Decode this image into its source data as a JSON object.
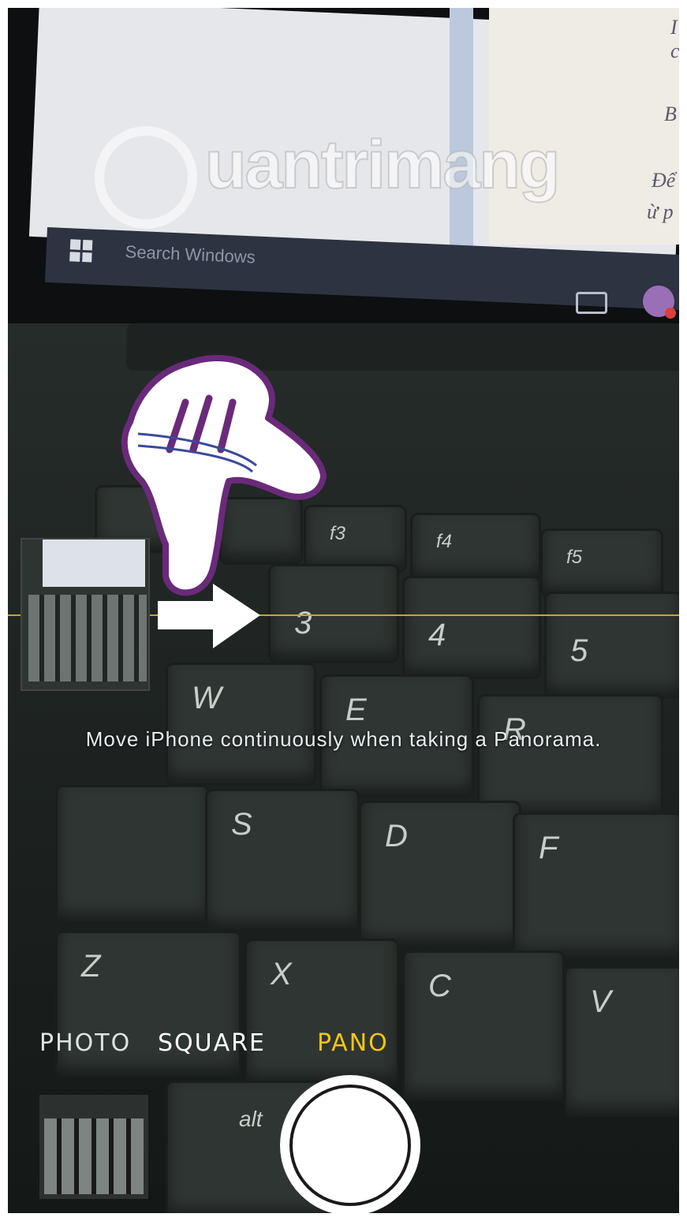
{
  "background": {
    "screen": {
      "search_label": "Search Windows"
    },
    "watermark": "uantrimang"
  },
  "camera": {
    "hint": "Move iPhone continuously when taking a Panorama.",
    "modes": [
      {
        "label": "PHOTO"
      },
      {
        "label": "SQUARE"
      },
      {
        "label": "PANO",
        "selected": true
      }
    ],
    "accent_color": "#f3c614",
    "guide_line_color": "#c8a52a"
  },
  "keys": {
    "f3": "f3",
    "f4": "f4",
    "f5": "f5",
    "num3": "3",
    "num4": "4",
    "num5": "5",
    "w": "W",
    "e": "E",
    "r": "R",
    "s": "S",
    "d": "D",
    "f": "F",
    "z": "Z",
    "x": "X",
    "c": "C",
    "v": "V",
    "alt": "alt"
  },
  "icons": [
    "hand-pointer-icon",
    "pan-arrow-icon",
    "windows-logo-icon"
  ]
}
